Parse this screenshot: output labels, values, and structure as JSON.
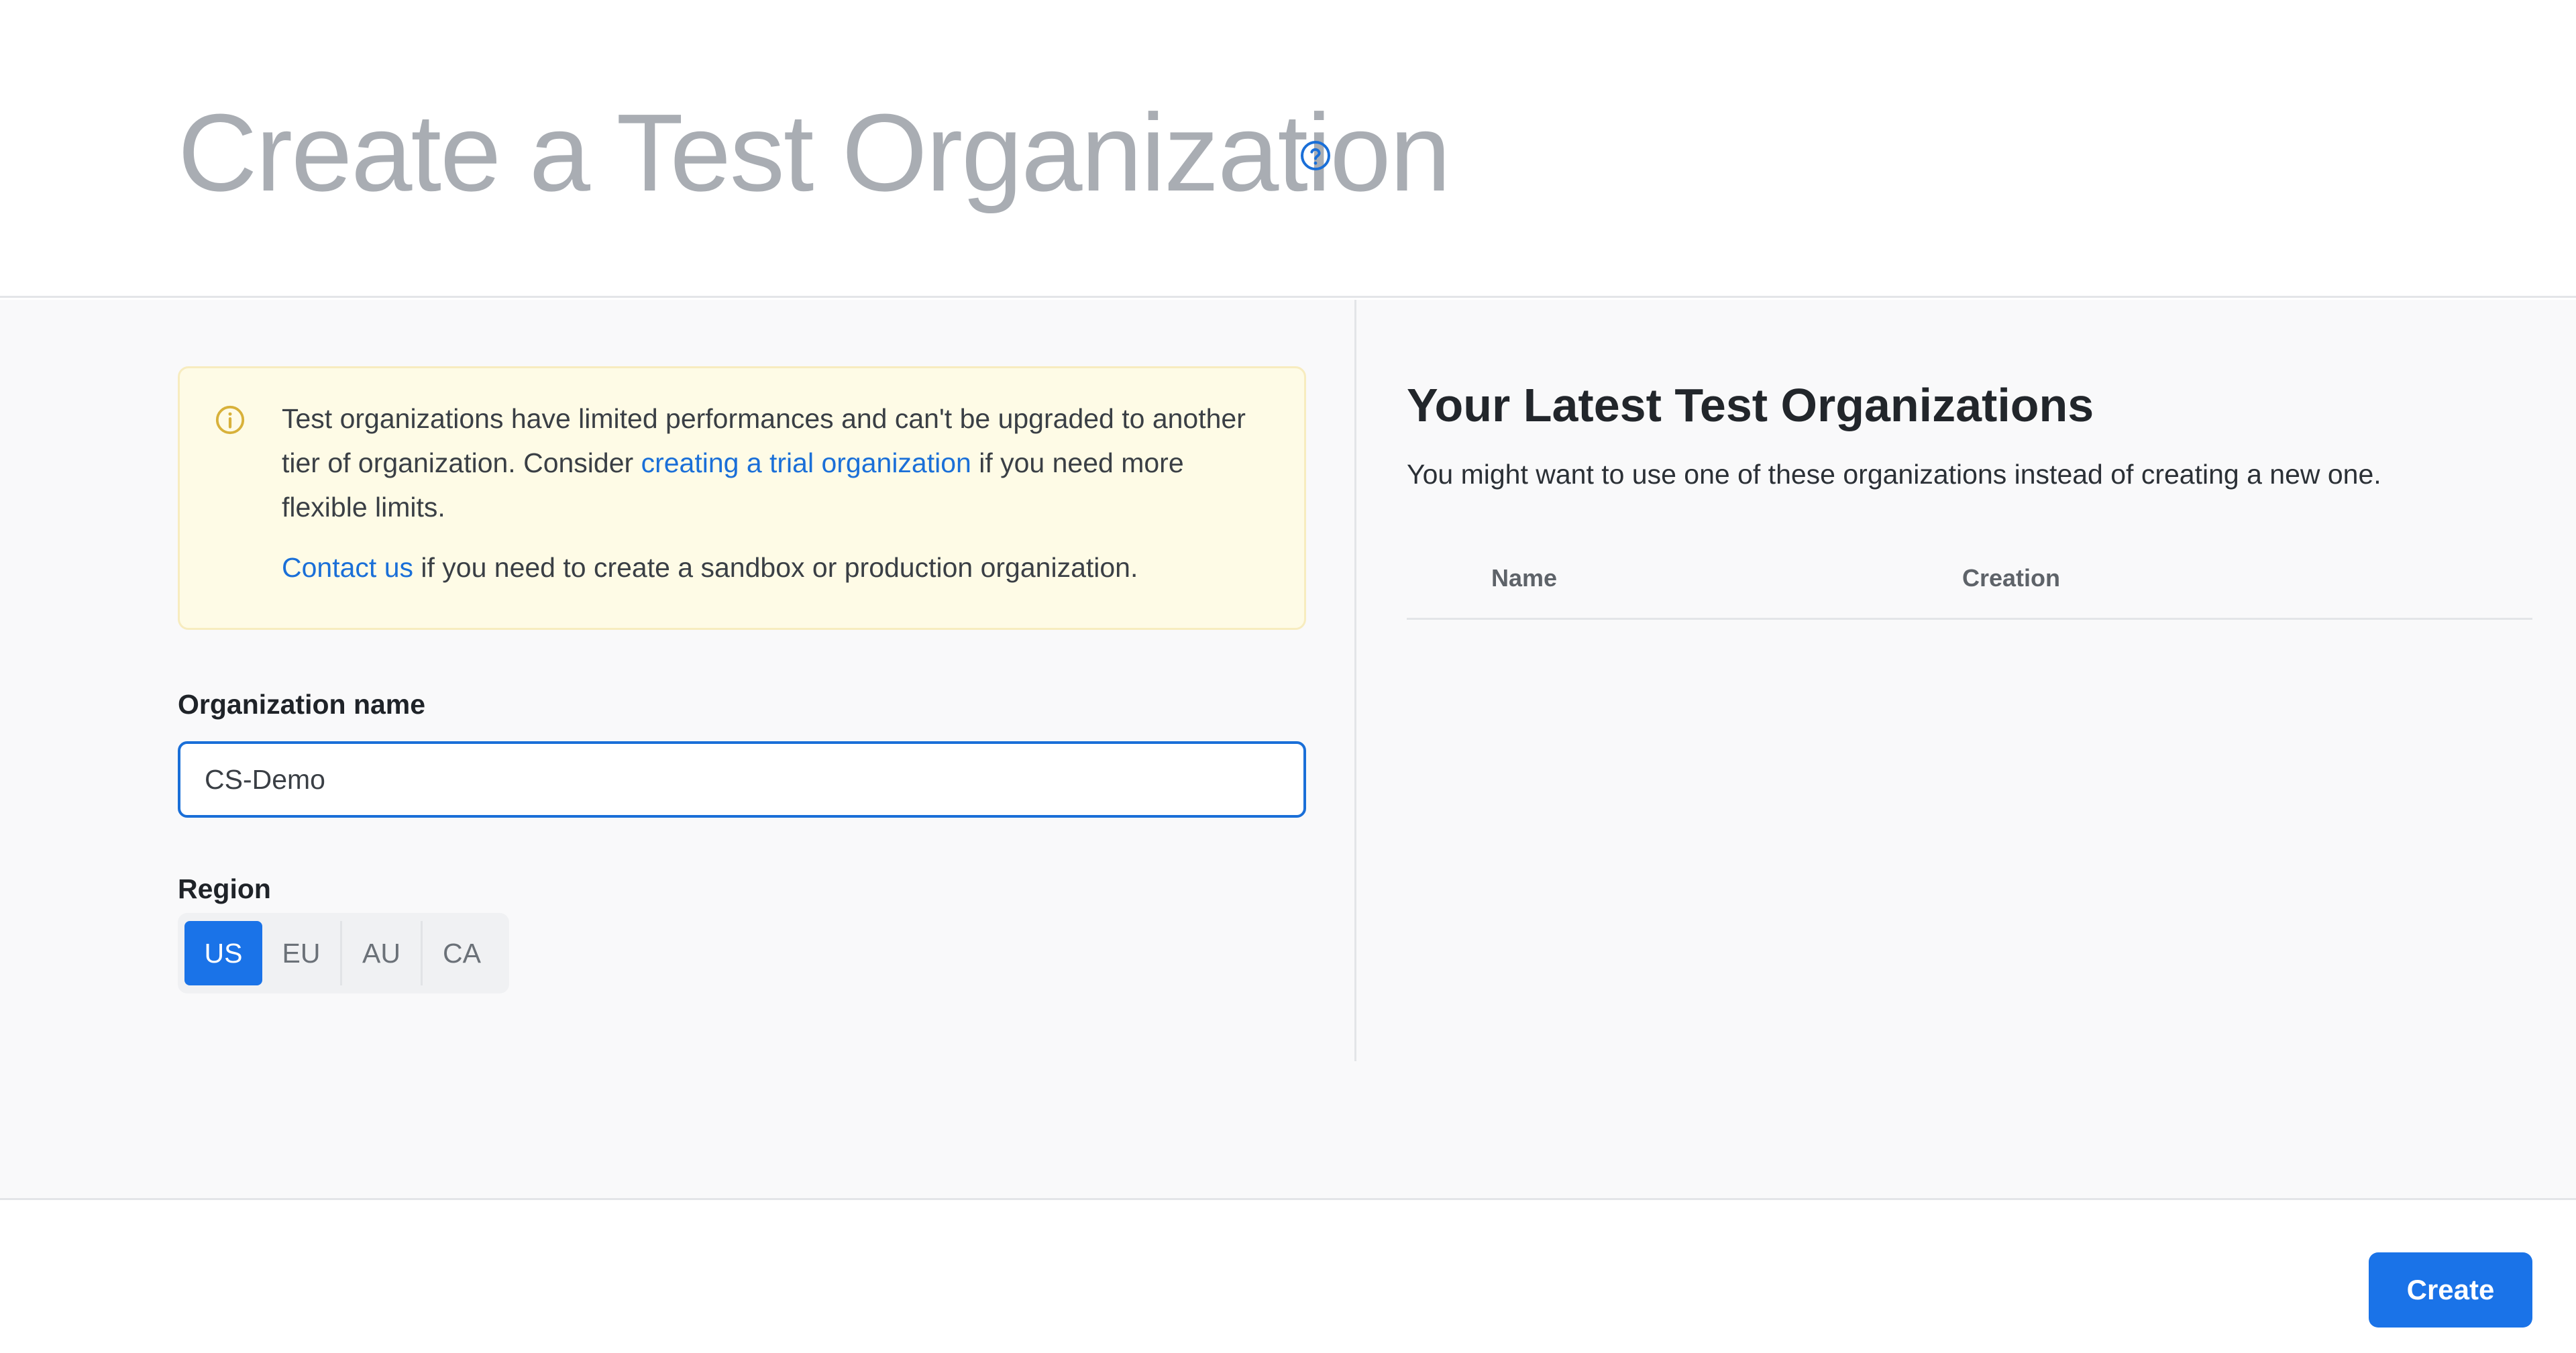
{
  "header": {
    "title": "Create a Test Organization",
    "help_icon": "question-circle-icon"
  },
  "notice": {
    "icon": "info-circle-icon",
    "line1_before": "Test organizations have limited performances and can't be upgraded to another tier of organization. Consider ",
    "line1_link": "creating a trial organization",
    "line1_after": " if you need more flexible limits.",
    "line2_link": "Contact us",
    "line2_after": " if you need to create a sandbox or production organization."
  },
  "form": {
    "org_name_label": "Organization name",
    "org_name_value": "CS-Demo",
    "region_label": "Region",
    "regions": [
      "US",
      "EU",
      "AU",
      "CA"
    ],
    "selected_region": "US"
  },
  "latest": {
    "title": "Your Latest Test Organizations",
    "subtitle": "You might want to use one of these organizations instead of creating a new one.",
    "columns": [
      "Name",
      "Creation"
    ]
  },
  "footer": {
    "create_label": "Create"
  },
  "colors": {
    "accent": "#1a73e8",
    "link": "#1a6fd8",
    "notice_bg": "#fefbe6",
    "notice_icon": "#d8b13a"
  }
}
